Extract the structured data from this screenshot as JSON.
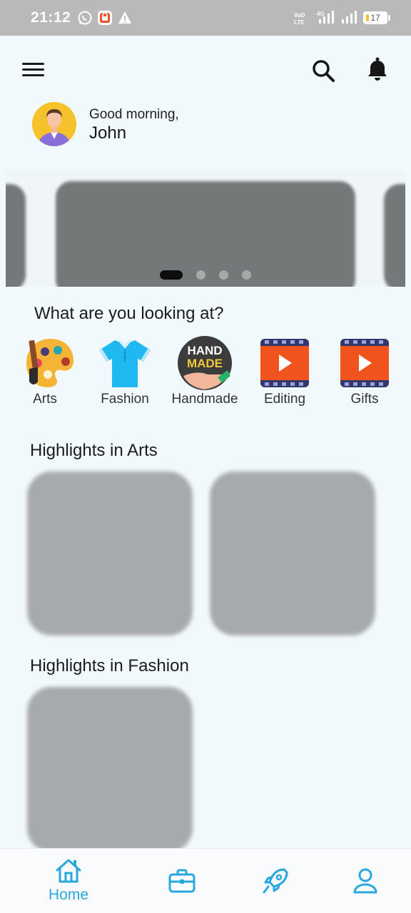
{
  "status_bar": {
    "time": "21:12",
    "battery": "17",
    "battery_level": 0.17
  },
  "header": {
    "menu_icon": "hamburger-menu-icon",
    "search_icon": "search-icon",
    "notification_icon": "bell-icon"
  },
  "user": {
    "greeting": "Good morning,",
    "name": "John"
  },
  "carousel": {
    "slide_count": 4,
    "active_index": 0
  },
  "categories": {
    "title": "What are you looking at?",
    "items": [
      {
        "label": "Arts",
        "icon": "palette-icon"
      },
      {
        "label": "Fashion",
        "icon": "tshirt-icon"
      },
      {
        "label": "Handmade",
        "icon": "handmade-badge-icon",
        "badge_line1": "HAND",
        "badge_line2": "MADE"
      },
      {
        "label": "Editing",
        "icon": "video-play-icon"
      },
      {
        "label": "Gifts",
        "icon": "video-play-icon"
      }
    ]
  },
  "highlights": [
    {
      "title": "Highlights in Arts"
    },
    {
      "title": "Highlights in Fashion"
    }
  ],
  "bottom_nav": {
    "items": [
      {
        "label": "Home",
        "icon": "home-icon",
        "active": true
      },
      {
        "label": "",
        "icon": "briefcase-icon",
        "active": false
      },
      {
        "label": "",
        "icon": "rocket-icon",
        "active": false
      },
      {
        "label": "",
        "icon": "profile-icon",
        "active": false
      }
    ]
  },
  "colors": {
    "accent": "#29a7df",
    "background": "#f2f9fc",
    "status_bar": "#b9b9b9",
    "placeholder": "#a7aaad"
  }
}
